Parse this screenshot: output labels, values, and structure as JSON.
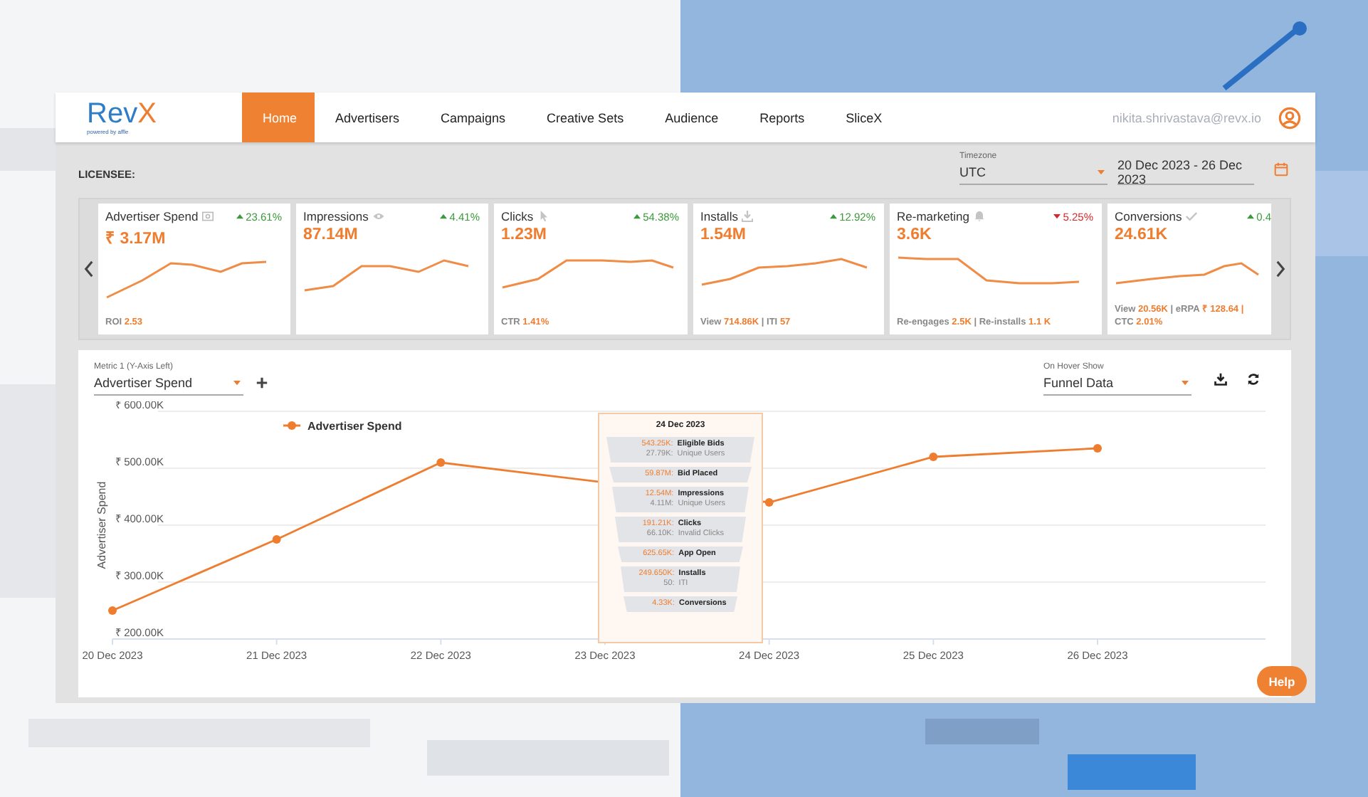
{
  "header": {
    "logo": "Rev",
    "logo_accent": "X",
    "powered_by": "powered by affle",
    "user_email": "nikita.shrivastava@revx.io"
  },
  "nav": [
    {
      "label": "Home",
      "selected": true
    },
    {
      "label": "Advertisers",
      "selected": false
    },
    {
      "label": "Campaigns",
      "selected": false
    },
    {
      "label": "Creative Sets",
      "selected": false
    },
    {
      "label": "Audience",
      "selected": false
    },
    {
      "label": "Reports",
      "selected": false
    },
    {
      "label": "SliceX",
      "selected": false
    }
  ],
  "licensee": "LICENSEE:",
  "timezone": {
    "label": "Timezone",
    "value": "UTC"
  },
  "date_range": {
    "value": "20 Dec 2023 - 26 Dec 2023"
  },
  "kpi_cards": [
    {
      "title": "Advertiser Spend",
      "change": "23.61%",
      "rising": true,
      "value": "₹ 3.17M",
      "footer": [
        {
          "label": "ROI",
          "value": "2.53"
        }
      ]
    },
    {
      "title": "Impressions",
      "change": "4.41%",
      "rising": true,
      "value": "87.14M"
    },
    {
      "title": "Clicks",
      "change": "54.38%",
      "rising": true,
      "value": "1.23M",
      "footer": [
        {
          "label": "CTR",
          "value": "1.41%"
        }
      ]
    },
    {
      "title": "Installs",
      "change": "12.92%",
      "rising": true,
      "value": "1.54M",
      "footer": [
        {
          "label": "View",
          "value": "714.86K"
        },
        {
          "label": "| ITI",
          "value": "57"
        }
      ]
    },
    {
      "title": "Re-marketing",
      "change": "5.25%",
      "rising": false,
      "value": "3.6K",
      "footer": [
        {
          "label": "Re-engages",
          "value": "2.5K"
        },
        {
          "label": "| Re-installs",
          "value": "1.1 K"
        }
      ]
    },
    {
      "title": "Conversions",
      "change": "0.4",
      "rising": true,
      "value": "24.61K",
      "footer": [
        {
          "label": "View",
          "value": "20.56K"
        },
        {
          "label": "| eRPA",
          "value": "₹ 128.64 |"
        },
        {
          "label": "CTC",
          "value": "2.01%"
        }
      ]
    }
  ],
  "metric_select": {
    "label": "Metric 1 (Y-Axis Left)",
    "value": "Advertiser Spend"
  },
  "hover_select": {
    "label": "On Hover Show",
    "value": "Funnel Data"
  },
  "help": "Help",
  "chart": {
    "chart_data": {
      "type": "line",
      "grid": true,
      "ylabel": "Advertiser Spend",
      "categories": [
        "20 Dec 2023",
        "21 Dec 2023",
        "22 Dec 2023",
        "23 Dec 2023",
        "24 Dec 2023",
        "25 Dec 2023",
        "26 Dec 2023"
      ],
      "series": [
        {
          "name": "Advertiser Spend",
          "color": "#ef7d2f",
          "marker": true,
          "values": [
            250000,
            375000,
            510000,
            null,
            440000,
            520000,
            535000
          ]
        }
      ],
      "ylim": [
        200000,
        600000
      ],
      "yticks": [
        {
          "value": 200000,
          "label": "₹ 200.00K"
        },
        {
          "value": 300000,
          "label": "₹ 300.00K"
        },
        {
          "value": 400000,
          "label": "₹ 400.00K"
        },
        {
          "value": 500000,
          "label": "₹ 500.00K"
        },
        {
          "value": 600000,
          "label": "₹ 600.00K"
        }
      ]
    }
  },
  "tooltip": {
    "title": "24 Dec 2023",
    "rows": [
      {
        "value": "543.25K:",
        "label": "Eligible Bids",
        "sub_value": "27.79K:",
        "sub_label": "Unique Users"
      },
      {
        "value": "59.87M:",
        "label": "Bid Placed"
      },
      {
        "value": "12.54M:",
        "label": "Impressions",
        "sub_value": "4.11M:",
        "sub_label": "Unique Users"
      },
      {
        "value": "191.21K:",
        "label": "Clicks",
        "sub_value": "66.10K:",
        "sub_label": "Invalid Clicks"
      },
      {
        "value": "625.65K:",
        "label": "App Open"
      },
      {
        "value": "249.650K:",
        "label": "Installs",
        "sub_value": "50:",
        "sub_label": "ITI"
      },
      {
        "value": "4.33K:",
        "label": "Conversions"
      }
    ]
  }
}
